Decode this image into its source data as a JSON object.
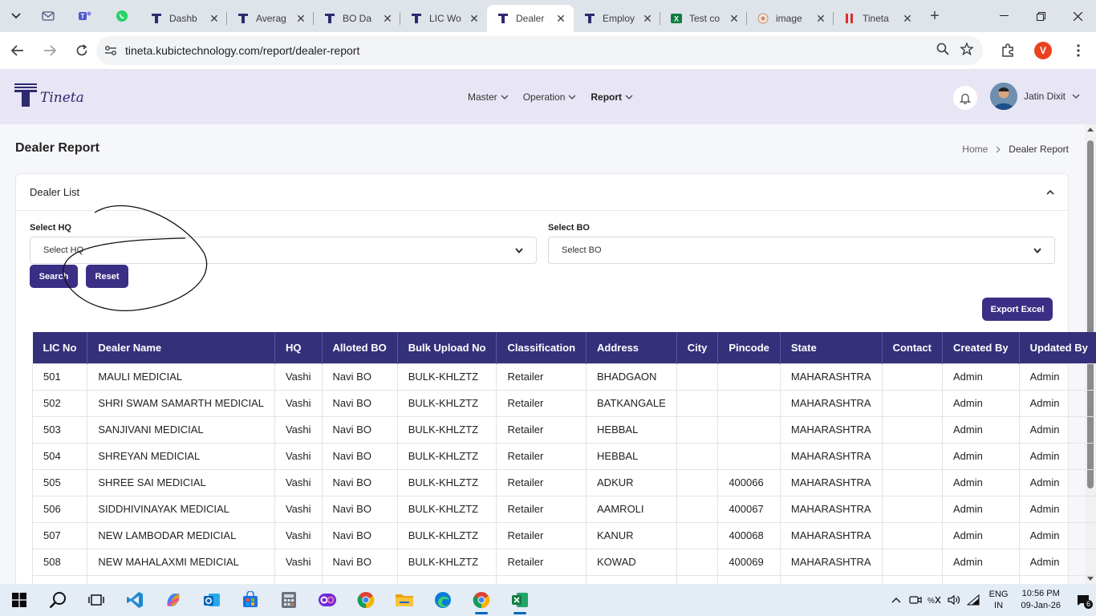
{
  "browser": {
    "tabs": [
      {
        "title": "Dashb",
        "favicon": "tineta-icon"
      },
      {
        "title": "Averag",
        "favicon": "tineta-icon"
      },
      {
        "title": "BO Da",
        "favicon": "tineta-icon"
      },
      {
        "title": "LIC Wo",
        "favicon": "tineta-icon"
      },
      {
        "title": "Dealer",
        "favicon": "tineta-icon",
        "active": true
      },
      {
        "title": "Employ",
        "favicon": "tineta-icon"
      },
      {
        "title": "Test co",
        "favicon": "excel-icon"
      },
      {
        "title": "image",
        "favicon": "image-icon"
      },
      {
        "title": "Tineta",
        "favicon": "tineta-red-icon"
      }
    ],
    "url": "tineta.kubictechnology.com/report/dealer-report",
    "profile_initial": "V"
  },
  "header": {
    "logo_text": "Tineta",
    "nav": [
      {
        "label": "Master"
      },
      {
        "label": "Operation"
      },
      {
        "label": "Report"
      }
    ],
    "user_name": "Jatin Dixit"
  },
  "page": {
    "title": "Dealer Report",
    "breadcrumb_home": "Home",
    "breadcrumb_current": "Dealer Report"
  },
  "card": {
    "title": "Dealer List",
    "hq_label": "Select HQ",
    "hq_value": "Select HQ",
    "bo_label": "Select BO",
    "bo_value": "Select BO",
    "search_label": "Search",
    "reset_label": "Reset",
    "export_label": "Export Excel"
  },
  "table": {
    "headers": [
      "LIC No",
      "Dealer Name",
      "HQ",
      "Alloted BO",
      "Bulk Upload No",
      "Classification",
      "Address",
      "City",
      "Pincode",
      "State",
      "Contact",
      "Created By",
      "Updated By"
    ],
    "rows": [
      [
        "501",
        "MAULI MEDICIAL",
        "Vashi",
        "Navi BO",
        "BULK-KHLZTZ",
        "Retailer",
        "BHADGAON",
        "",
        "",
        "MAHARASHTRA",
        "",
        "Admin",
        "Admin"
      ],
      [
        "502",
        "SHRI SWAM SAMARTH MEDICIAL",
        "Vashi",
        "Navi BO",
        "BULK-KHLZTZ",
        "Retailer",
        "BATKANGALE",
        "",
        "",
        "MAHARASHTRA",
        "",
        "Admin",
        "Admin"
      ],
      [
        "503",
        "SANJIVANI MEDICIAL",
        "Vashi",
        "Navi BO",
        "BULK-KHLZTZ",
        "Retailer",
        "HEBBAL",
        "",
        "",
        "MAHARASHTRA",
        "",
        "Admin",
        "Admin"
      ],
      [
        "504",
        "SHREYAN MEDICIAL",
        "Vashi",
        "Navi BO",
        "BULK-KHLZTZ",
        "Retailer",
        "HEBBAL",
        "",
        "",
        "MAHARASHTRA",
        "",
        "Admin",
        "Admin"
      ],
      [
        "505",
        "SHREE SAI MEDICIAL",
        "Vashi",
        "Navi BO",
        "BULK-KHLZTZ",
        "Retailer",
        "ADKUR",
        "",
        "400066",
        "MAHARASHTRA",
        "",
        "Admin",
        "Admin"
      ],
      [
        "506",
        "SIDDHIVINAYAK MEDICIAL",
        "Vashi",
        "Navi BO",
        "BULK-KHLZTZ",
        "Retailer",
        "AAMROLI",
        "",
        "400067",
        "MAHARASHTRA",
        "",
        "Admin",
        "Admin"
      ],
      [
        "507",
        "NEW LAMBODAR MEDICIAL",
        "Vashi",
        "Navi BO",
        "BULK-KHLZTZ",
        "Retailer",
        "KANUR",
        "",
        "400068",
        "MAHARASHTRA",
        "",
        "Admin",
        "Admin"
      ],
      [
        "508",
        "NEW MAHALAXMI MEDICIAL",
        "Vashi",
        "Navi BO",
        "BULK-KHLZTZ",
        "Retailer",
        "KOWAD",
        "",
        "400069",
        "MAHARASHTRA",
        "",
        "Admin",
        "Admin"
      ],
      [
        "",
        "",
        "",
        "",
        "",
        "",
        "",
        "",
        "",
        "",
        "",
        "",
        ""
      ]
    ]
  },
  "taskbar": {
    "apps": [
      "windows-start-icon",
      "search-icon",
      "task-view-icon",
      "vscode-icon",
      "copilot-icon",
      "outlook-icon",
      "store-icon",
      "calculator-icon",
      "clipchamp-icon",
      "chrome-icon",
      "file-explorer-icon",
      "edge-icon",
      "chrome-active-icon",
      "excel-icon"
    ],
    "lang_line1": "ENG",
    "lang_line2": "IN",
    "time": "10:56 PM",
    "date": "09-Jan-26",
    "notification_count": "6"
  },
  "colors": {
    "primary": "#35307a",
    "header_bg": "#e8e5f5",
    "button": "#3a2f84"
  }
}
